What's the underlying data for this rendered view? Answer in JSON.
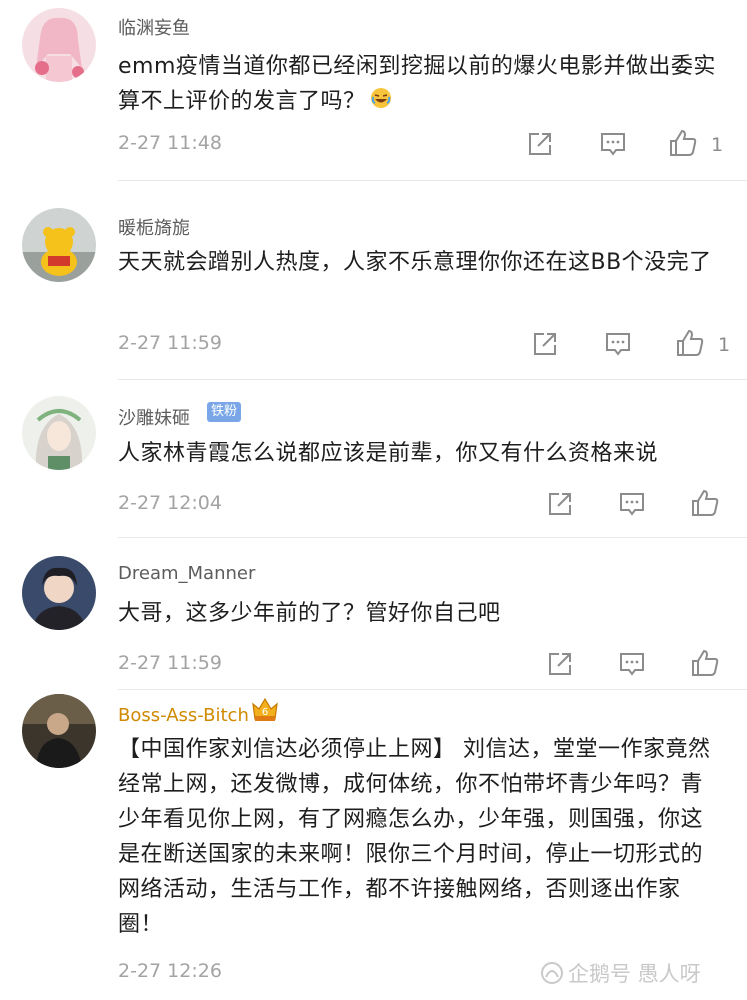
{
  "comments": [
    {
      "username": "临渊妄鱼",
      "text": "emm疫情当道你都已经闲到挖掘以前的爆火电影并做出委实算不上评价的发言了吗？",
      "emoji": "laughing-tears-emoji",
      "time": "2-27 11:48",
      "likes": "1"
    },
    {
      "username": "暖栀旖旎",
      "text": "天天就会蹭别人热度，人家不乐意理你你还在这BB个没完了",
      "time": "2-27 11:59",
      "likes": "1"
    },
    {
      "username": "沙雕妹砸",
      "badge": "铁粉",
      "text": "人家林青霞怎么说都应该是前辈，你又有什么资格来说",
      "time": "2-27 12:04",
      "likes": ""
    },
    {
      "username": "Dream_Manner",
      "text": "大哥，这多少年前的了？管好你自己吧",
      "time": "2-27 11:59",
      "likes": ""
    },
    {
      "username": "Boss-Ass-Bitch",
      "badge": "6",
      "text": "【中国作家刘信达必须停止上网】 刘信达，堂堂一作家竟然经常上网，还发微博，成何体统，你不怕带坏青少年吗？青少年看见你上网，有了网瘾怎么办，少年强，则国强，你这是在断送国家的未来啊！限你三个月时间，停止一切形式的网络活动，生活与工作，都不许接触网络，否则逐出作家圈！",
      "time": "2-27 12:26",
      "likes": ""
    }
  ],
  "watermark": "企鹅号 愚人呀",
  "colors": {
    "username": "#5c5c5c",
    "vip_username": "#d08a00",
    "time": "#a3a3a3",
    "icon": "#8c8c8c",
    "fan_badge": "#7aa6e8"
  },
  "icons": [
    "share-icon",
    "comment-icon",
    "like-icon"
  ]
}
